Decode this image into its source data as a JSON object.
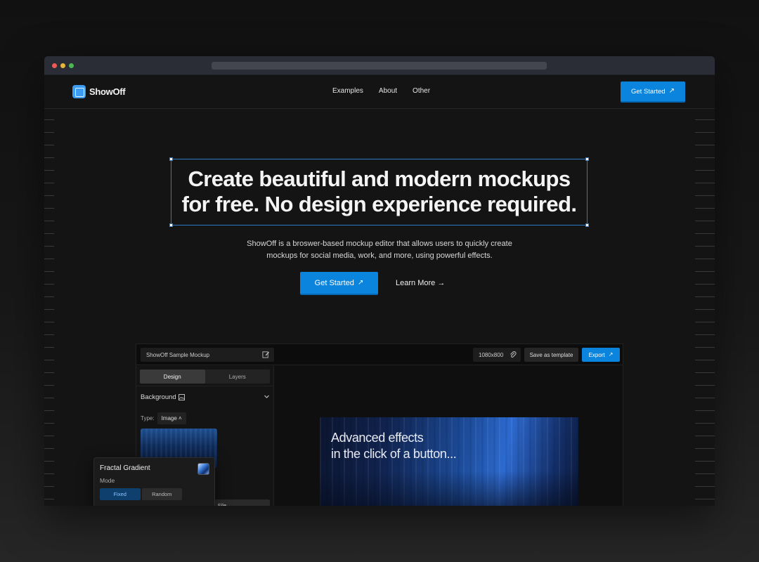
{
  "site": {
    "logo_text": "ShowOff",
    "nav": [
      "Examples",
      "About",
      "Other"
    ],
    "nav_cta": "Get Started"
  },
  "hero": {
    "headline_line1": "Create beautiful and modern mockups",
    "headline_line2": "for free. No design experience required.",
    "subtitle_line1": "ShowOff is a broswer-based mockup editor that allows users to quickly create",
    "subtitle_line2": "mockups for social media, work, and more, using powerful effects.",
    "primary_cta": "Get Started",
    "secondary_cta": "Learn More"
  },
  "editor": {
    "project_name": "ShowOff Sample Mockup",
    "dimensions": "1080x800",
    "save_template": "Save as template",
    "export": "Export",
    "tabs": [
      "Design",
      "Layers"
    ],
    "background_section": "Background",
    "type_label": "Type:",
    "type_value": "Image",
    "file_button": "File",
    "canvas_line1": "Advanced effects",
    "canvas_line2": "in the click of a button..."
  },
  "fractal_panel": {
    "title": "Fractal Gradient",
    "mode_label": "Mode",
    "options": [
      "Fixed",
      "Random"
    ]
  },
  "colors": {
    "accent": "#0a84dd",
    "selection": "#2b7bc9",
    "background": "#141414"
  }
}
